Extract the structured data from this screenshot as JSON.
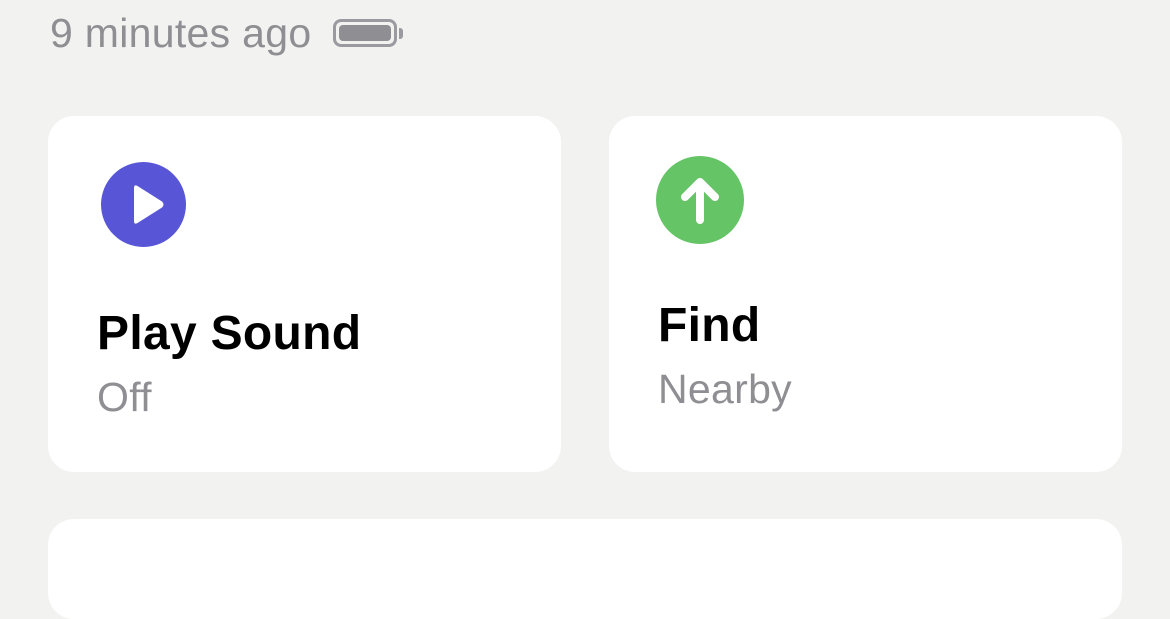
{
  "status": {
    "last_seen": "9 minutes ago",
    "battery_icon": "battery-full-icon",
    "battery_level": 1.0
  },
  "actions": {
    "play_sound": {
      "title": "Play Sound",
      "subtitle": "Off",
      "icon": "play-icon",
      "icon_color": "#5856D6"
    },
    "find": {
      "title": "Find",
      "subtitle": "Nearby",
      "icon": "arrow-up-icon",
      "icon_color": "#65C466"
    }
  },
  "colors": {
    "background": "#F2F2F0",
    "card": "#FFFFFF",
    "secondary_text": "#8E8E93",
    "primary_text": "#000000"
  }
}
